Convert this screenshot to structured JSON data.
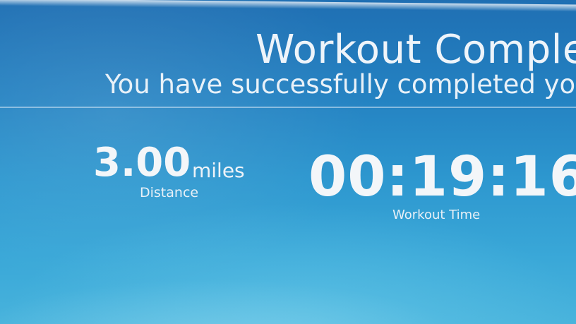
{
  "header": {
    "title": "Workout Complete",
    "subtitle": "You have successfully completed your"
  },
  "stats": {
    "distance": {
      "value": "3.00",
      "unit": "miles",
      "label": "Distance"
    },
    "workout_time": {
      "value": "00:19:16",
      "label": "Workout Time"
    }
  },
  "colors": {
    "background_top": "#1f6fb3",
    "background_bottom": "#48b3dc",
    "text": "#f3f6f9"
  }
}
